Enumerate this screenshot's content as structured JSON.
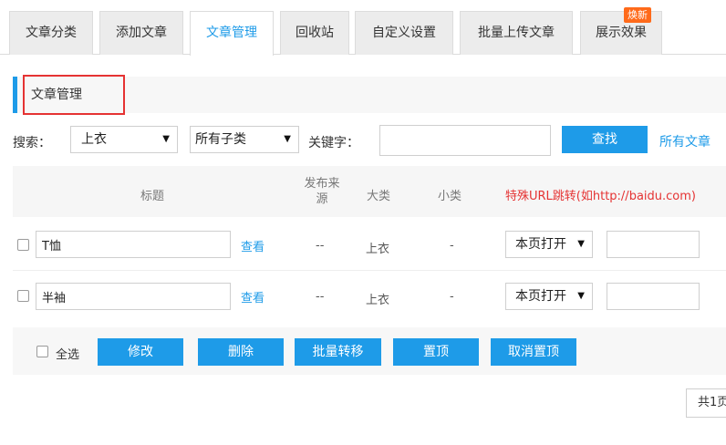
{
  "tabs": [
    {
      "label": "文章分类",
      "active": false
    },
    {
      "label": "添加文章",
      "active": false
    },
    {
      "label": "文章管理",
      "active": true
    },
    {
      "label": "回收站",
      "active": false
    },
    {
      "label": "自定义设置",
      "active": false
    },
    {
      "label": "批量上传文章",
      "active": false
    },
    {
      "label": "展示效果",
      "active": false,
      "badge": "焕新"
    }
  ],
  "section": {
    "title": "文章管理"
  },
  "search": {
    "label": "搜索：",
    "category_selected": "上衣",
    "subcategory_selected": "所有子类",
    "keyword_label": "关键字：",
    "keyword_value": "",
    "search_button": "查找",
    "all_articles_link": "所有文章"
  },
  "table": {
    "headers": {
      "title": "标题",
      "source": "发布来源",
      "major": "大类",
      "minor": "小类",
      "special_url": "特殊URL跳转(如http://baidu.com)"
    },
    "rows": [
      {
        "title": "T恤",
        "view": "查看",
        "source": "--",
        "major": "上衣",
        "minor": "-",
        "open_mode": "本页打开",
        "url": ""
      },
      {
        "title": "半袖",
        "view": "查看",
        "source": "--",
        "major": "上衣",
        "minor": "-",
        "open_mode": "本页打开",
        "url": ""
      }
    ]
  },
  "actions": {
    "select_all": "全选",
    "edit": "修改",
    "delete": "删除",
    "batch_move": "批量转移",
    "pin": "置顶",
    "unpin": "取消置顶"
  },
  "pagination": {
    "text": "共1页"
  },
  "colors": {
    "accent": "#1e9be8",
    "highlight_red": "#e53333",
    "badge_orange": "#ff6a1a"
  }
}
